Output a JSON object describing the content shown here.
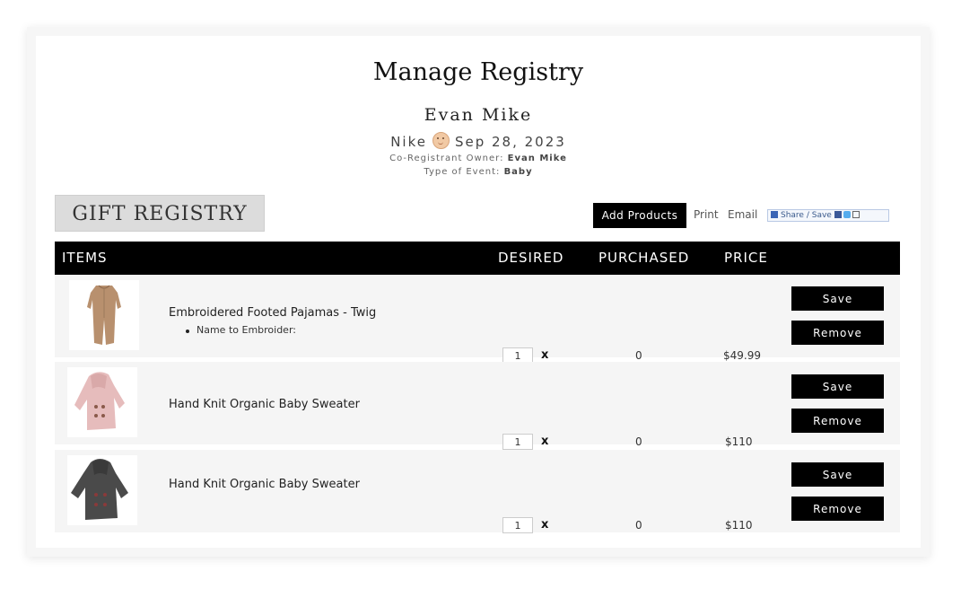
{
  "header": {
    "title": "Manage Registry",
    "owner_name": "Evan Mike",
    "event_brand": "Nike",
    "event_icon": "baby-face-icon",
    "event_date": "Sep 28, 2023",
    "co_registrant_label": "Co-Registrant Owner:",
    "co_registrant_value": "Evan Mike",
    "event_type_label": "Type of Event:",
    "event_type_value": "Baby"
  },
  "toolbar": {
    "heading": "GIFT REGISTRY",
    "add_products_label": "Add Products",
    "print_label": "Print",
    "email_label": "Email",
    "share_label": "Share / Save"
  },
  "table": {
    "columns": [
      "ITEMS",
      "DESIRED",
      "PURCHASED",
      "PRICE"
    ],
    "items": [
      {
        "name": "Embroidered Footed Pajamas - Twig",
        "detail": "Name to Embroider:",
        "desired": "1",
        "multiplier": "x",
        "purchased": "0",
        "price": "$49.99",
        "save_label": "Save",
        "remove_label": "Remove",
        "image_color": "#b8906e"
      },
      {
        "name": "Hand Knit Organic Baby Sweater",
        "desired": "1",
        "multiplier": "x",
        "purchased": "0",
        "price": "$110",
        "save_label": "Save",
        "remove_label": "Remove",
        "image_color": "#e6bcbc"
      },
      {
        "name": "Hand Knit Organic Baby Sweater",
        "desired": "1",
        "multiplier": "x",
        "purchased": "0",
        "price": "$110",
        "save_label": "Save",
        "remove_label": "Remove",
        "image_color": "#4a4a4a"
      }
    ]
  },
  "colors": {
    "header_bg": "#000000",
    "row_bg": "#f5f5f5",
    "button_bg": "#000000"
  }
}
